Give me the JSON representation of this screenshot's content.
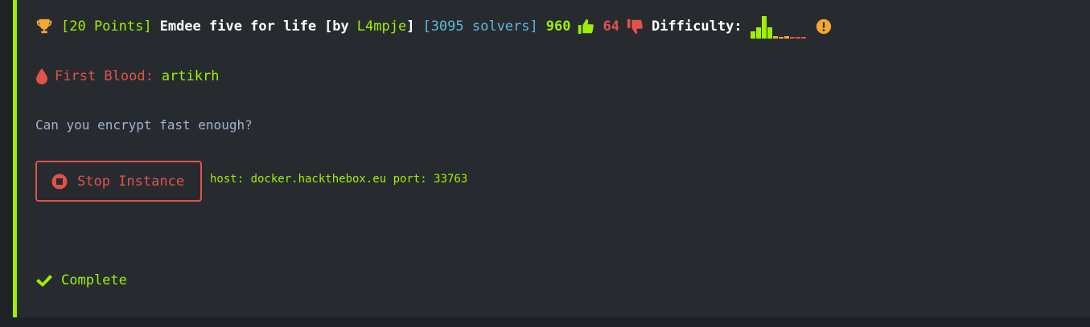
{
  "challenge": {
    "points": "[20 Points]",
    "name": "Emdee five for life",
    "by_open": "[by",
    "author": "L4mpje",
    "by_close": "]",
    "solvers": "[3095 solvers]",
    "likes": "960",
    "dislikes": "64",
    "difficulty_label": "Difficulty:",
    "difficulty_levels": [
      0.33,
      0.5,
      1.0,
      0.5,
      0.12,
      0.08,
      0.12,
      0.06,
      0.04,
      0.04
    ],
    "difficulty_colors": [
      "#9fef00",
      "#9fef00",
      "#9fef00",
      "#9fef00",
      "#f5a733",
      "#f5a733",
      "#f5a733",
      "#e0524a",
      "#e0524a",
      "#e0524a"
    ],
    "first_blood_label": "First Blood:",
    "first_blood_user": "artikrh",
    "description": "Can you encrypt fast enough?",
    "stop_button_label": "Stop Instance",
    "host_info": "host: docker.hackthebox.eu port: 33763",
    "status": "Complete"
  },
  "icons": {
    "trophy": "trophy-icon",
    "thumbs_up": "thumbs-up-icon",
    "thumbs_down": "thumbs-down-icon",
    "warning": "exclamation-circle-icon",
    "blood": "blood-drop-icon",
    "stop": "stop-circle-icon",
    "check": "check-icon"
  },
  "colors": {
    "accent": "#9fef00",
    "danger": "#e0524a",
    "info": "#5cb8e0",
    "warning": "#f5a733",
    "panel": "#272b30"
  }
}
